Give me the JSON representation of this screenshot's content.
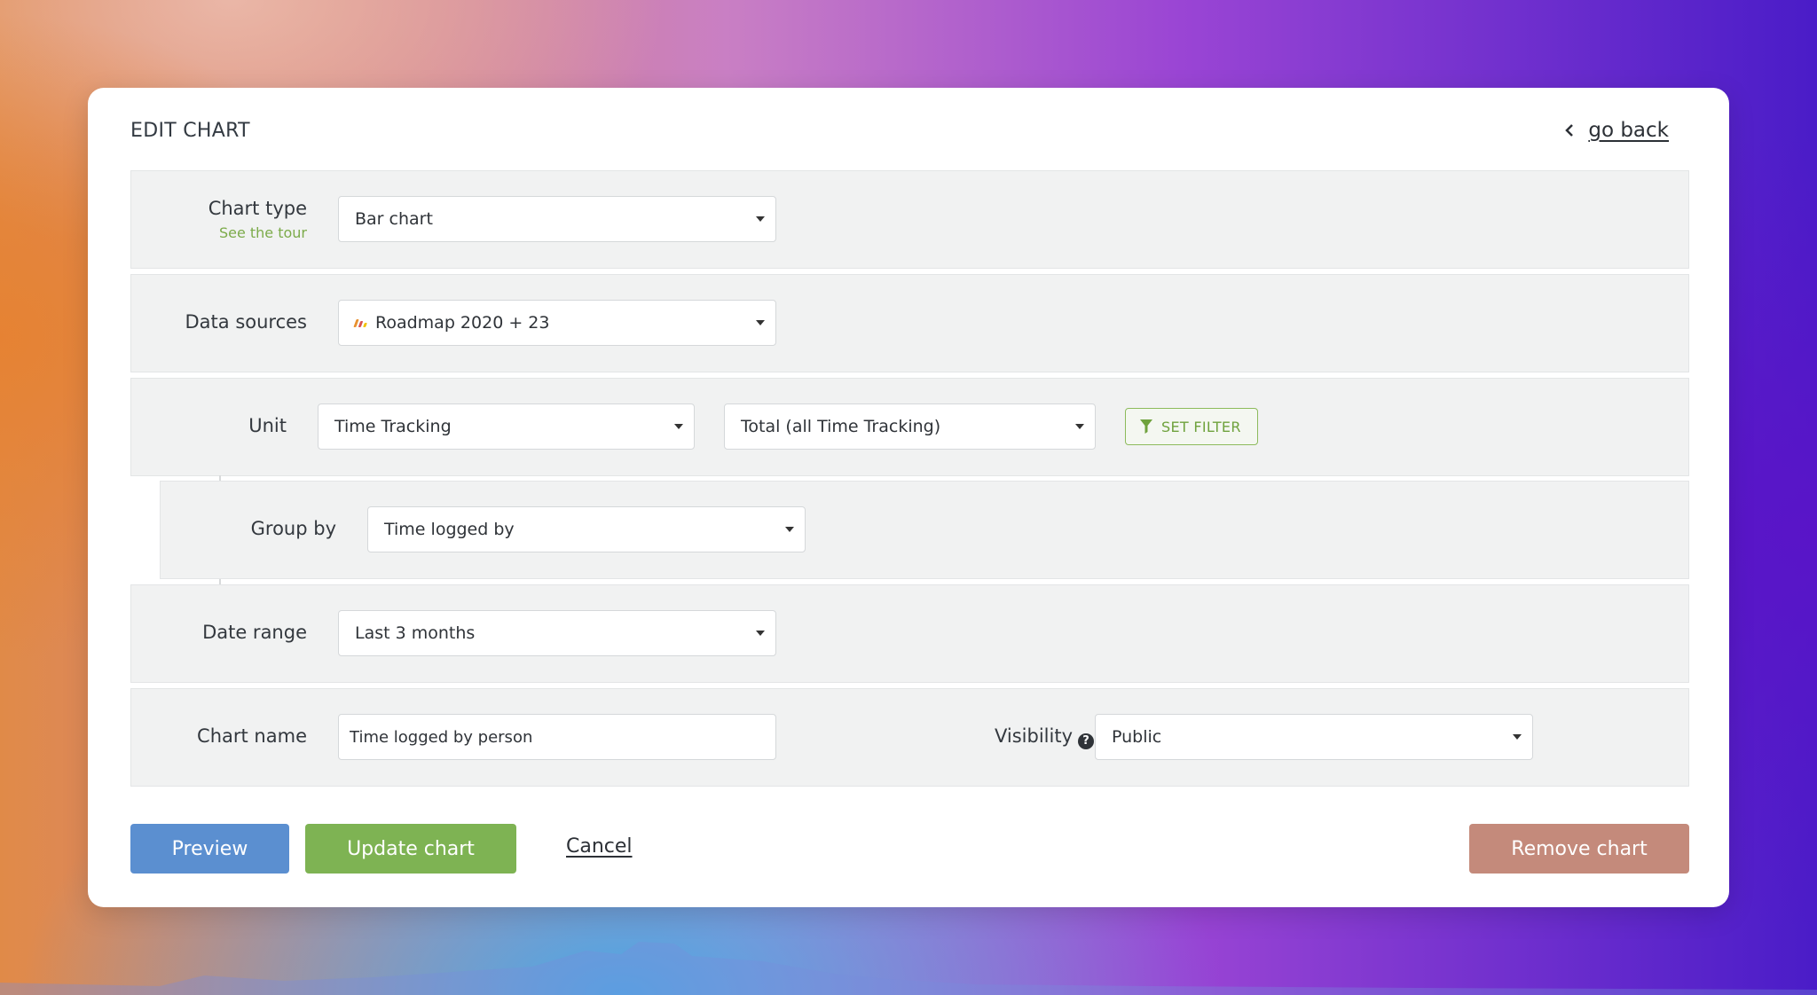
{
  "header": {
    "title": "EDIT CHART",
    "go_back_label": "go back"
  },
  "chart_type": {
    "label": "Chart type",
    "tour_link": "See the tour",
    "value": "Bar chart"
  },
  "data_sources": {
    "label": "Data sources",
    "value": "Roadmap 2020 + 23",
    "icon_colors": [
      "#e8912f",
      "#d9534f",
      "#f2c200"
    ]
  },
  "unit": {
    "label": "Unit",
    "value": "Time Tracking",
    "aggregate_value": "Total (all Time Tracking)",
    "filter_label": "SET FILTER"
  },
  "group_by": {
    "label": "Group by",
    "value": "Time logged by"
  },
  "date_range": {
    "label": "Date range",
    "value": "Last 3 months"
  },
  "chart_name": {
    "label": "Chart name",
    "value": "Time logged by person"
  },
  "visibility": {
    "label": "Visibility",
    "help_glyph": "?",
    "value": "Public"
  },
  "actions": {
    "preview_label": "Preview",
    "update_label": "Update chart",
    "cancel_label": "Cancel",
    "remove_label": "Remove chart"
  },
  "colors": {
    "preview": "#5b8fd0",
    "update": "#7eb353",
    "remove": "#c48a7b",
    "accent_green": "#7cab4a"
  }
}
